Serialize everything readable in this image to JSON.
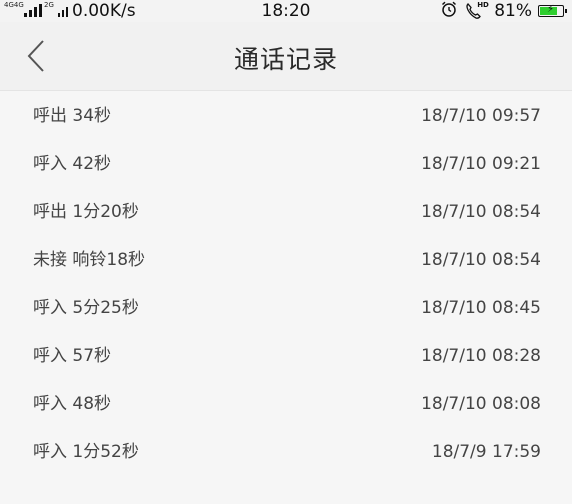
{
  "status_bar": {
    "network_labels": [
      "4G",
      "4G",
      "2G"
    ],
    "net_speed": "0.00K/s",
    "time": "18:20",
    "alarm_icon": "alarm-clock-icon",
    "hd_call_icon": "hd-call-icon",
    "hd_label": "HD",
    "battery_percent": "81%",
    "battery_level": 0.81,
    "battery_color": "#2fce2f",
    "charging": true
  },
  "header": {
    "back_icon": "chevron-left-icon",
    "title": "通话记录"
  },
  "calls": [
    {
      "desc": "呼出  34秒",
      "time": "18/7/10 09:57"
    },
    {
      "desc": "呼入  42秒",
      "time": "18/7/10 09:21"
    },
    {
      "desc": "呼出  1分20秒",
      "time": "18/7/10 08:54"
    },
    {
      "desc": "未接  响铃18秒",
      "time": "18/7/10 08:54"
    },
    {
      "desc": "呼入  5分25秒",
      "time": "18/7/10 08:45"
    },
    {
      "desc": "呼入  57秒",
      "time": "18/7/10 08:28"
    },
    {
      "desc": "呼入  48秒",
      "time": "18/7/10 08:08"
    },
    {
      "desc": "呼入  1分52秒",
      "time": "18/7/9 17:59"
    }
  ]
}
